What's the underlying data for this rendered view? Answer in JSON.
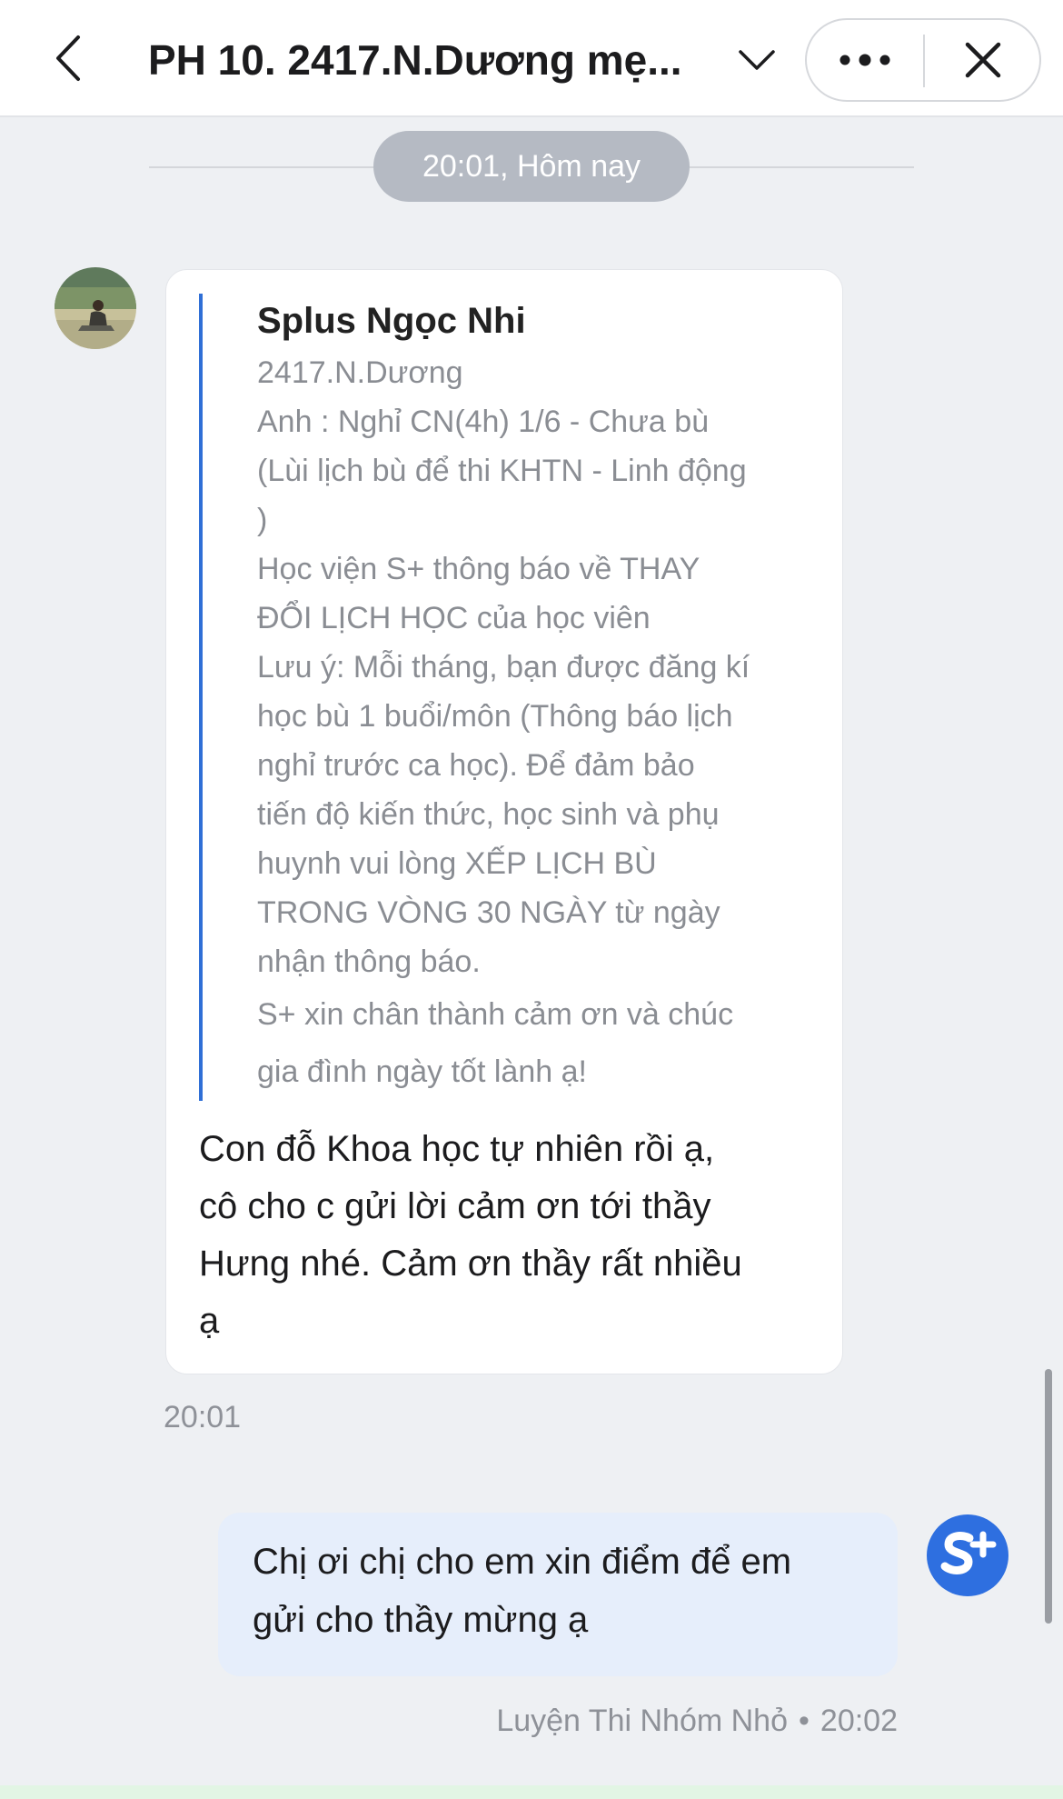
{
  "header": {
    "title": "PH 10. 2417.N.Dương mẹ..."
  },
  "date_separator": "20:01, Hôm nay",
  "incoming": {
    "quote": {
      "sender": "Splus Ngọc Nhi",
      "lines": [
        "2417.N.Dương",
        "Anh : Nghỉ CN(4h) 1/6 - Chưa bù",
        "(Lùi lịch bù để thi KHTN - Linh động",
        ")",
        "Học viện S+ thông báo về THAY",
        "ĐỔI LỊCH HỌC của học viên",
        "Lưu ý: Mỗi tháng, bạn được đăng kí",
        "học bù 1 buổi/môn (Thông báo lịch",
        "nghỉ trước ca học). Để đảm bảo",
        "tiến độ kiến thức, học sinh và phụ",
        "huynh vui lòng XẾP LỊCH BÙ",
        "TRONG VÒNG 30 NGÀY từ ngày",
        "nhận thông báo."
      ],
      "closing_lines": [
        "S+ xin chân thành cảm ơn và chúc",
        "gia đình ngày tốt lành ạ!"
      ]
    },
    "text_lines": [
      "Con đỗ Khoa học tự nhiên rồi ạ,",
      "cô cho c gửi lời cảm ơn tới thầy",
      "Hưng nhé. Cảm ơn thầy rất nhiều",
      "ạ"
    ],
    "time": "20:01"
  },
  "outgoing": {
    "text_lines": [
      "Chị ơi chị cho em xin điểm để em",
      "gửi cho thầy mừng ạ"
    ],
    "sender": "Luyện Thi Nhóm Nhỏ",
    "separator": "•",
    "time": "20:02"
  },
  "icons": {
    "back": "chevron-left-icon",
    "title_toggle": "chevron-down-icon",
    "more": "more-horizontal-icon",
    "close": "close-icon",
    "brand_avatar": "splus-logo"
  },
  "colors": {
    "accent": "#2f6fd6",
    "brand_blue": "#2e6fe0",
    "background": "#eef0f3",
    "outgoing_bubble": "#e6eefb",
    "date_chip": "#b5bac3"
  }
}
